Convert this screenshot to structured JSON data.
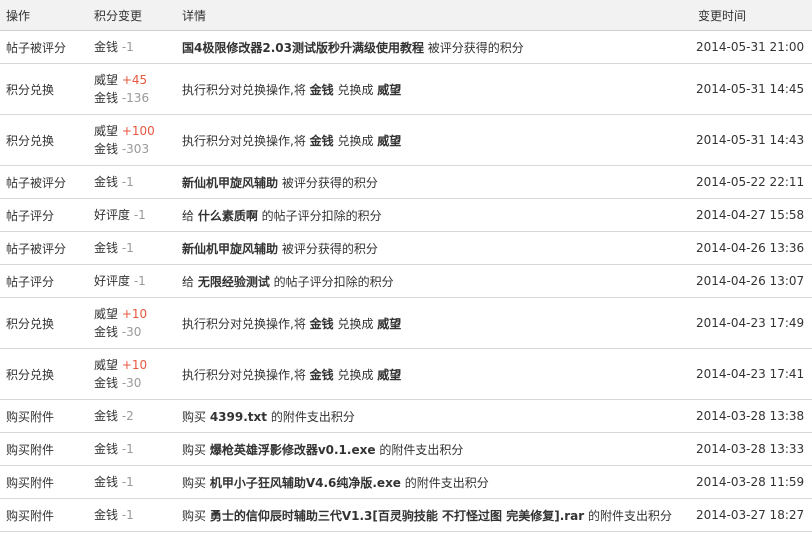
{
  "headers": {
    "action": "操作",
    "change": "积分变更",
    "detail": "详情",
    "time": "变更时间"
  },
  "rows": [
    {
      "action": "帖子被评分",
      "changes": [
        {
          "label": "金钱",
          "amount": "-1",
          "positive": false
        }
      ],
      "detail": [
        {
          "t": "国4极限修改器2.03测试版秒升满级使用教程",
          "b": true
        },
        {
          "t": " 被评分获得的积分",
          "b": false
        }
      ],
      "time": "2014-05-31 21:00"
    },
    {
      "action": "积分兑换",
      "changes": [
        {
          "label": "威望",
          "amount": "+45",
          "positive": true
        },
        {
          "label": "金钱",
          "amount": "-136",
          "positive": false
        }
      ],
      "detail": [
        {
          "t": "执行积分对兑换操作,将 ",
          "b": false
        },
        {
          "t": "金钱",
          "b": true
        },
        {
          "t": " 兑换成 ",
          "b": false
        },
        {
          "t": "威望",
          "b": true
        }
      ],
      "time": "2014-05-31 14:45"
    },
    {
      "action": "积分兑换",
      "changes": [
        {
          "label": "威望",
          "amount": "+100",
          "positive": true
        },
        {
          "label": "金钱",
          "amount": "-303",
          "positive": false
        }
      ],
      "detail": [
        {
          "t": "执行积分对兑换操作,将 ",
          "b": false
        },
        {
          "t": "金钱",
          "b": true
        },
        {
          "t": " 兑换成 ",
          "b": false
        },
        {
          "t": "威望",
          "b": true
        }
      ],
      "time": "2014-05-31 14:43"
    },
    {
      "action": "帖子被评分",
      "changes": [
        {
          "label": "金钱",
          "amount": "-1",
          "positive": false
        }
      ],
      "detail": [
        {
          "t": "新仙机甲旋风辅助",
          "b": true
        },
        {
          "t": " 被评分获得的积分",
          "b": false
        }
      ],
      "time": "2014-05-22 22:11"
    },
    {
      "action": "帖子评分",
      "changes": [
        {
          "label": "好评度",
          "amount": "-1",
          "positive": false
        }
      ],
      "detail": [
        {
          "t": "给 ",
          "b": false
        },
        {
          "t": "什么素质啊",
          "b": true
        },
        {
          "t": " 的帖子评分扣除的积分",
          "b": false
        }
      ],
      "time": "2014-04-27 15:58"
    },
    {
      "action": "帖子被评分",
      "changes": [
        {
          "label": "金钱",
          "amount": "-1",
          "positive": false
        }
      ],
      "detail": [
        {
          "t": "新仙机甲旋风辅助",
          "b": true
        },
        {
          "t": " 被评分获得的积分",
          "b": false
        }
      ],
      "time": "2014-04-26 13:36"
    },
    {
      "action": "帖子评分",
      "changes": [
        {
          "label": "好评度",
          "amount": "-1",
          "positive": false
        }
      ],
      "detail": [
        {
          "t": "给 ",
          "b": false
        },
        {
          "t": "无限经验测试",
          "b": true
        },
        {
          "t": " 的帖子评分扣除的积分",
          "b": false
        }
      ],
      "time": "2014-04-26 13:07"
    },
    {
      "action": "积分兑换",
      "changes": [
        {
          "label": "威望",
          "amount": "+10",
          "positive": true
        },
        {
          "label": "金钱",
          "amount": "-30",
          "positive": false
        }
      ],
      "detail": [
        {
          "t": "执行积分对兑换操作,将 ",
          "b": false
        },
        {
          "t": "金钱",
          "b": true
        },
        {
          "t": " 兑换成 ",
          "b": false
        },
        {
          "t": "威望",
          "b": true
        }
      ],
      "time": "2014-04-23 17:49"
    },
    {
      "action": "积分兑换",
      "changes": [
        {
          "label": "威望",
          "amount": "+10",
          "positive": true
        },
        {
          "label": "金钱",
          "amount": "-30",
          "positive": false
        }
      ],
      "detail": [
        {
          "t": "执行积分对兑换操作,将 ",
          "b": false
        },
        {
          "t": "金钱",
          "b": true
        },
        {
          "t": " 兑换成 ",
          "b": false
        },
        {
          "t": "威望",
          "b": true
        }
      ],
      "time": "2014-04-23 17:41"
    },
    {
      "action": "购买附件",
      "changes": [
        {
          "label": "金钱",
          "amount": "-2",
          "positive": false
        }
      ],
      "detail": [
        {
          "t": "购买 ",
          "b": false
        },
        {
          "t": "4399.txt",
          "b": true
        },
        {
          "t": " 的附件支出积分",
          "b": false
        }
      ],
      "time": "2014-03-28 13:38"
    },
    {
      "action": "购买附件",
      "changes": [
        {
          "label": "金钱",
          "amount": "-1",
          "positive": false
        }
      ],
      "detail": [
        {
          "t": "购买 ",
          "b": false
        },
        {
          "t": "爆枪英雄浮影修改器v0.1.exe",
          "b": true
        },
        {
          "t": " 的附件支出积分",
          "b": false
        }
      ],
      "time": "2014-03-28 13:33"
    },
    {
      "action": "购买附件",
      "changes": [
        {
          "label": "金钱",
          "amount": "-1",
          "positive": false
        }
      ],
      "detail": [
        {
          "t": "购买 ",
          "b": false
        },
        {
          "t": "机甲小子狂风辅助V4.6纯净版.exe",
          "b": true
        },
        {
          "t": " 的附件支出积分",
          "b": false
        }
      ],
      "time": "2014-03-28 11:59"
    },
    {
      "action": "购买附件",
      "changes": [
        {
          "label": "金钱",
          "amount": "-1",
          "positive": false
        }
      ],
      "detail": [
        {
          "t": "购买 ",
          "b": false
        },
        {
          "t": "勇士的信仰辰时辅助三代V1.3[百灵驹技能 不打怪过图 完美修复].rar",
          "b": true
        },
        {
          "t": " 的附件支出积分",
          "b": false
        }
      ],
      "time": "2014-03-27 18:27"
    }
  ]
}
